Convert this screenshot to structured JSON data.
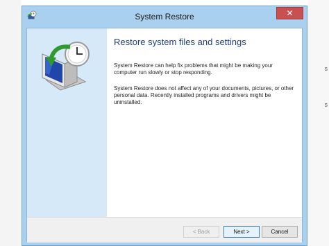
{
  "window": {
    "title": "System Restore",
    "close_label": "✕"
  },
  "content": {
    "heading": "Restore system files and settings",
    "paragraph1": "System Restore can help fix problems that might be making your computer run slowly or stop responding.",
    "paragraph2": "System Restore does not affect any of your documents, pictures, or other personal data. Recently installed programs and drivers might be uninstalled."
  },
  "buttons": {
    "back": "< Back",
    "next": "Next >",
    "cancel": "Cancel"
  },
  "background": {
    "fragment1": "s",
    "fragment2": "s"
  },
  "icons": {
    "title": "system-restore-icon",
    "hero": "system-restore-clock-icon"
  },
  "colors": {
    "frame": "#a9d0ee",
    "heading": "#1d3f7a",
    "sidebar": "#d6e9f8",
    "close": "#c75050"
  }
}
